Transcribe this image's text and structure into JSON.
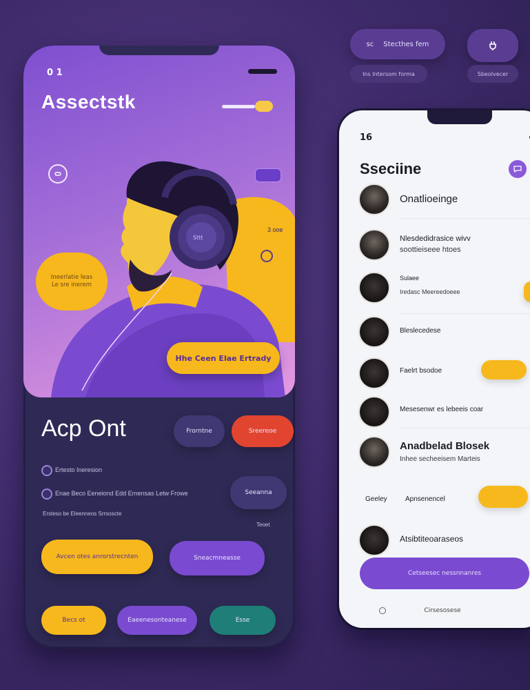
{
  "floating": {
    "chip1_label": "Stecthes fem",
    "chip1_prefix": "sc",
    "chip1_sub": "Ins Intersom forma",
    "chip2_icon": "plug-icon",
    "chip2_sub": "Sbeolvecer"
  },
  "left_phone": {
    "status_time": "0 1",
    "hero_title": "Assectstk",
    "hero_circle_small": "",
    "hero_headphone_label": "Sttt",
    "hero_side_text": "3 ooe",
    "hero_badge_text": "Ineerlatie leas Le sre inerem",
    "hero_cta": "Hhe Ceen Elae Ertrady",
    "section_title": "Acp Ont",
    "pill_dark_1": "Frorntne",
    "pill_red": "Sreereoe",
    "row1_text": "Ertesto Ineresion",
    "row2_text": "Enae Beco Eeneiond Edd Ernensas Letw Frowe",
    "row3_text": "Ersteso be Eleenneos Srrsoscte",
    "pill_dark_2": "Seeanna",
    "pill_dark_2_caption": "Teoet",
    "btn_yellow_1": "Avcen otes anrorstrecnten",
    "btn_purple_1": "Sneacmneasse",
    "btn_yellow_2": "Becs ot",
    "btn_purple_2": "Eaeenesonteanese",
    "btn_teal": "Esse",
    "colors": {
      "accent_yellow": "#f6b81c",
      "accent_purple": "#7a4bd0",
      "accent_red": "#e2452f",
      "accent_teal": "#1f7f78",
      "dark_bg": "#2f2a55"
    }
  },
  "right_phone": {
    "status_time": "16",
    "title": "Sseciine",
    "badge_icon": "chat-icon",
    "items": [
      {
        "title": "Onatlioeinge",
        "sub": ""
      },
      {
        "title": "Nlesdedidrasice  wivv",
        "sub": "soottieiseee htoes"
      },
      {
        "title": "Sulaee",
        "sub": "Iredasc   Meereedoeee"
      },
      {
        "title": "Bleslecedese",
        "sub": ""
      },
      {
        "title": "Faelrt bsodoe",
        "sub": ""
      },
      {
        "title": "Mesesenwr es lebeeis coar",
        "sub": ""
      },
      {
        "title": "Anadbelad Blosek",
        "sub": "Inhee secheeisem Marteis"
      },
      {
        "title": "Geeley",
        "sub": "Apnsenencel"
      },
      {
        "title": "Atsibtiteoaraseos",
        "sub": ""
      }
    ],
    "cta_label": "Cetseesec nessnnanres",
    "footer": "Cirsesosese"
  }
}
